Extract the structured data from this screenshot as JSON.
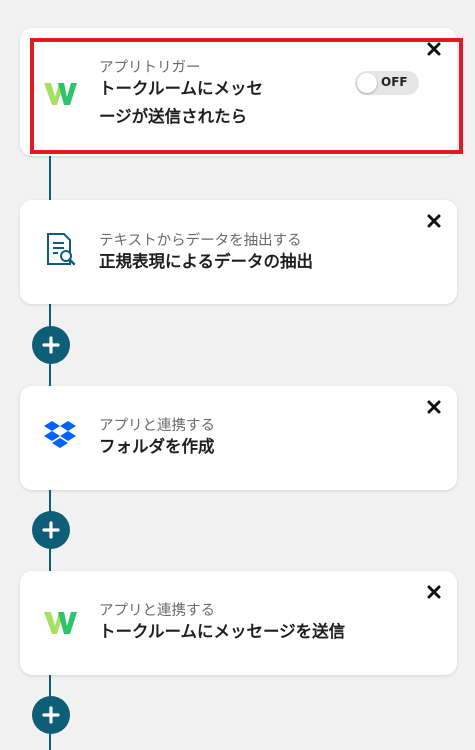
{
  "flow": {
    "steps": [
      {
        "subtitle": "アプリトリガー",
        "title_line1": "トークルームにメッセ",
        "title_line2": "ージが送信されたら",
        "icon": "w-app-logo-icon",
        "toggle_label": "OFF",
        "selected": true
      },
      {
        "subtitle": "テキストからデータを抽出する",
        "title": "正規表現によるデータの抽出",
        "icon": "document-search-icon"
      },
      {
        "subtitle": "アプリと連携する",
        "title": "フォルダを作成",
        "icon": "dropbox-icon"
      },
      {
        "subtitle": "アプリと連携する",
        "title": "トークルームにメッセージを送信",
        "icon": "w-app-logo-icon"
      }
    ],
    "add_button_icon": "plus-icon",
    "close_button_icon": "close-icon"
  },
  "colors": {
    "accent": "#0e5e78",
    "selection_border": "#e4191f",
    "w_logo_light": "#a8e063",
    "w_logo_dark": "#2ec46a",
    "dropbox_blue": "#0061fe"
  }
}
